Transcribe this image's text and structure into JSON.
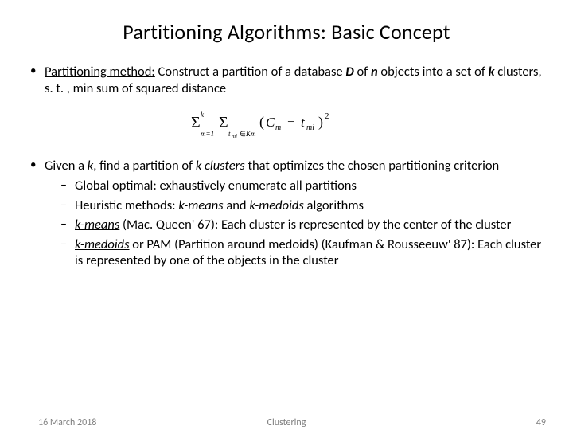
{
  "title": "Partitioning Algorithms: Basic Concept",
  "bullets": {
    "b1": {
      "lead": "Partitioning method:",
      "rest_a": " Construct a partition of a database ",
      "D": "D",
      "rest_b": " of ",
      "n": "n",
      "rest_c": " objects into a set of ",
      "k": "k",
      "rest_d": " clusters, s. t. , min sum of squared distance"
    },
    "b2": {
      "pre": "Given a ",
      "k1": "k",
      "mid": ", find a partition of ",
      "kc": "k clusters",
      "post": " that optimizes the chosen partitioning criterion",
      "s1": "Global optimal: exhaustively enumerate all partitions",
      "s2a": "Heuristic methods: ",
      "s2k": "k-means",
      "s2b": " and ",
      "s2m": "k-medoids",
      "s2c": " algorithms",
      "s3k": "k-means",
      "s3r": " (Mac. Queen' 67): Each cluster is represented by the center of the cluster",
      "s4k": "k-medoids",
      "s4r": " or PAM (Partition around medoids) (Kaufman & Rousseeuw' 87): Each cluster is represented by one of the objects in the cluster"
    }
  },
  "formula": {
    "tex": "\\sum_{m=1}^{k} \\sum_{t_{mi} \\in K_m} (C_m - t_{mi})^2"
  },
  "footer": {
    "date": "16 March 2018",
    "center": "Clustering",
    "page": "49"
  }
}
